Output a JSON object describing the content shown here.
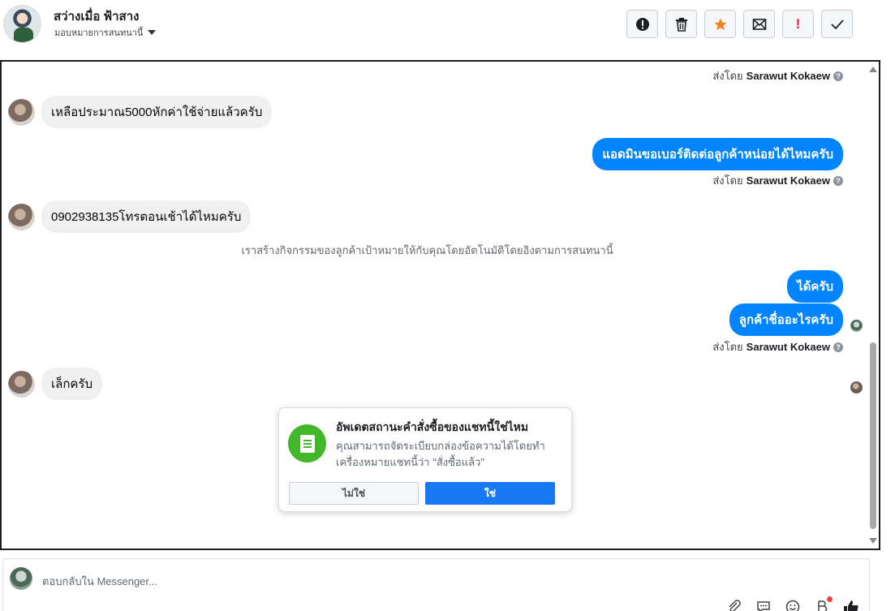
{
  "header": {
    "contact_name": "สว่างเมื่อ ฟ้าสาง",
    "assign_label": "มอบหมายการสนทนานี้",
    "actions": [
      {
        "name": "spam",
        "glyph": "❗"
      },
      {
        "name": "delete",
        "glyph": "🗑"
      },
      {
        "name": "star",
        "glyph": "★"
      },
      {
        "name": "mark-unread",
        "glyph": "✉"
      },
      {
        "name": "follow-up",
        "glyph": "!"
      },
      {
        "name": "done",
        "glyph": "✓"
      }
    ]
  },
  "conversation": {
    "sent_by_prefix": "ส่งโดย",
    "agent_name": "Sarawut Kokaew",
    "messages_in": [
      "เหลือประมาณ5000หักค่าใช้จ่ายแล้วครับ",
      "0902938135โทรตอนเช้าได้ไหมครับ",
      "เล็กครับ"
    ],
    "messages_out": [
      "แอดมินขอเบอร์ติดต่อลูกค้าหน่อยได้ไหมครับ",
      "ได้ครับ",
      "ลูกค้าชื่ออะไรครับ"
    ],
    "system_note": "เราสร้างกิจกรรมของลูกค้าเป้าหมายให้กับคุณโดยอัตโนมัติโดยอิงตามการสนทนานี้"
  },
  "popup": {
    "title": "อัพเดตสถานะคำสั่งซื้อของแชทนี้ใช่ไหม",
    "body": "คุณสามารถจัดระเบียบกล่องข้อความได้โดยทำเครื่องหมายแชทนี้ว่า \"สั่งซื้อแล้ว\"",
    "no_label": "ไม่ใช่",
    "yes_label": "ใช่"
  },
  "reply": {
    "placeholder": "ตอบกลับใน Messenger..."
  },
  "colors": {
    "outgoing_bubble": "#0084ff",
    "primary_button": "#1877f2",
    "order_icon_bg": "#42b72a",
    "star": "#f5821f"
  }
}
